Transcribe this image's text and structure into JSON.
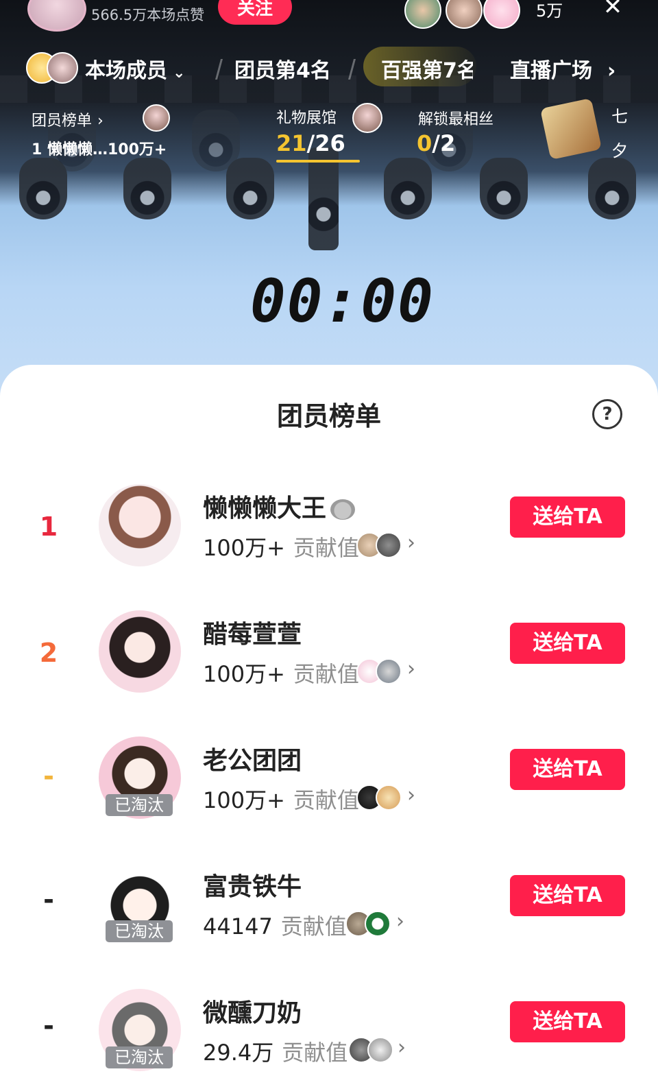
{
  "top_bar": {
    "likes_text": "566.5万本场点赞",
    "follow_label": "关注",
    "online_count": "5万",
    "close_icon": "close-icon"
  },
  "nav": {
    "members_label": "本场成员",
    "rank_label": "团员第4名",
    "top100_label": "百强第7名",
    "plaza_label": "直播广场"
  },
  "info": {
    "members_board_label": "团员榜单",
    "members_board_top": "1 懒懒懒…100万+",
    "gift_hall_label": "礼物展馆",
    "gift_hall_progress": "21",
    "gift_hall_total": "/26",
    "unlock_label": "解锁最相丝",
    "unlock_progress": "0",
    "unlock_total": "/2",
    "qixi_line1": "七",
    "qixi_line2": "夕",
    "accent_color": "#f4c430"
  },
  "timer": "00:00",
  "panel": {
    "title": "团员榜单",
    "help_symbol": "?"
  },
  "members": [
    {
      "rank": "1",
      "name": "懒懒懒大王",
      "score": "100万+",
      "score_label": "贡献值",
      "eliminated": "",
      "button": "送给TA",
      "rank_color": "#e8283e"
    },
    {
      "rank": "2",
      "name": "醋莓萱萱",
      "score": "100万+",
      "score_label": "贡献值",
      "eliminated": "",
      "button": "送给TA",
      "rank_color": "#f46a3a"
    },
    {
      "rank": "-",
      "name": "老公团团",
      "score": "100万+",
      "score_label": "贡献值",
      "eliminated": "已淘汰",
      "button": "送给TA",
      "rank_color": "#f2b43b"
    },
    {
      "rank": "-",
      "name": "富贵铁牛",
      "score": "44147",
      "score_label": "贡献值",
      "eliminated": "已淘汰",
      "button": "送给TA",
      "rank_color": "#222222"
    },
    {
      "rank": "-",
      "name": "微醺刀奶",
      "score": "29.4万",
      "score_label": "贡献值",
      "eliminated": "已淘汰",
      "button": "送给TA",
      "rank_color": "#222222"
    }
  ]
}
